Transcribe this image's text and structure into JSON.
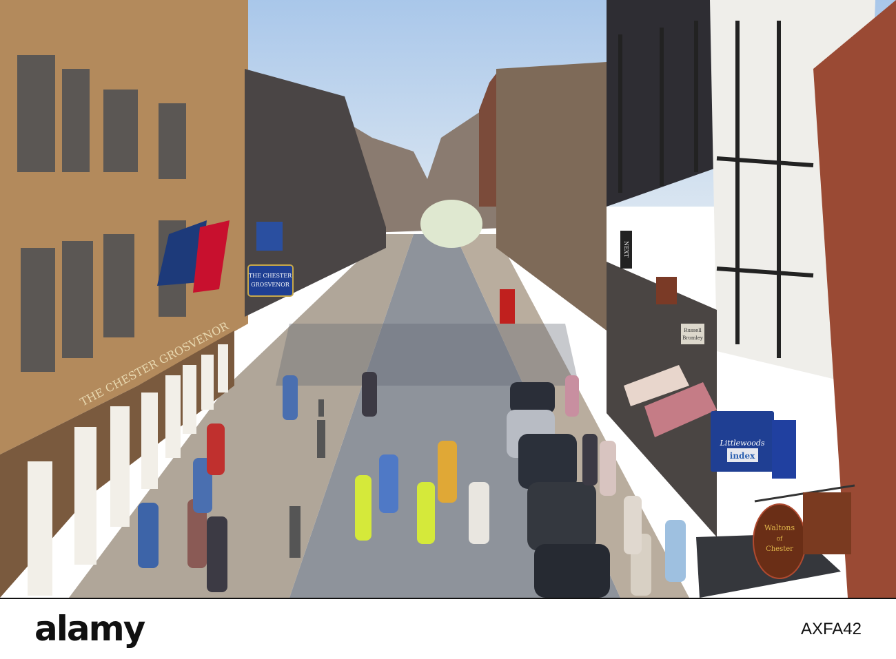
{
  "signs": {
    "hotel_hanging": [
      "THE CHESTER",
      "GROSVENOR"
    ],
    "hotel_facade": "THE CHESTER GROSVENOR",
    "next": "NEXT",
    "russell": [
      "Russell",
      "Bromley"
    ],
    "littlewoods": "Littlewoods",
    "index": "index",
    "waltons": [
      "Waltons",
      "of",
      "Chester"
    ]
  },
  "watermark": {
    "logo": "alamy",
    "image_code": "AXFA42"
  },
  "colors": {
    "sky": "#b9d3ee",
    "street": "#8e939b",
    "pavement": "#b7ab9c",
    "sign_blue": "#1f3f93",
    "sign_brown": "#6a2e16"
  }
}
